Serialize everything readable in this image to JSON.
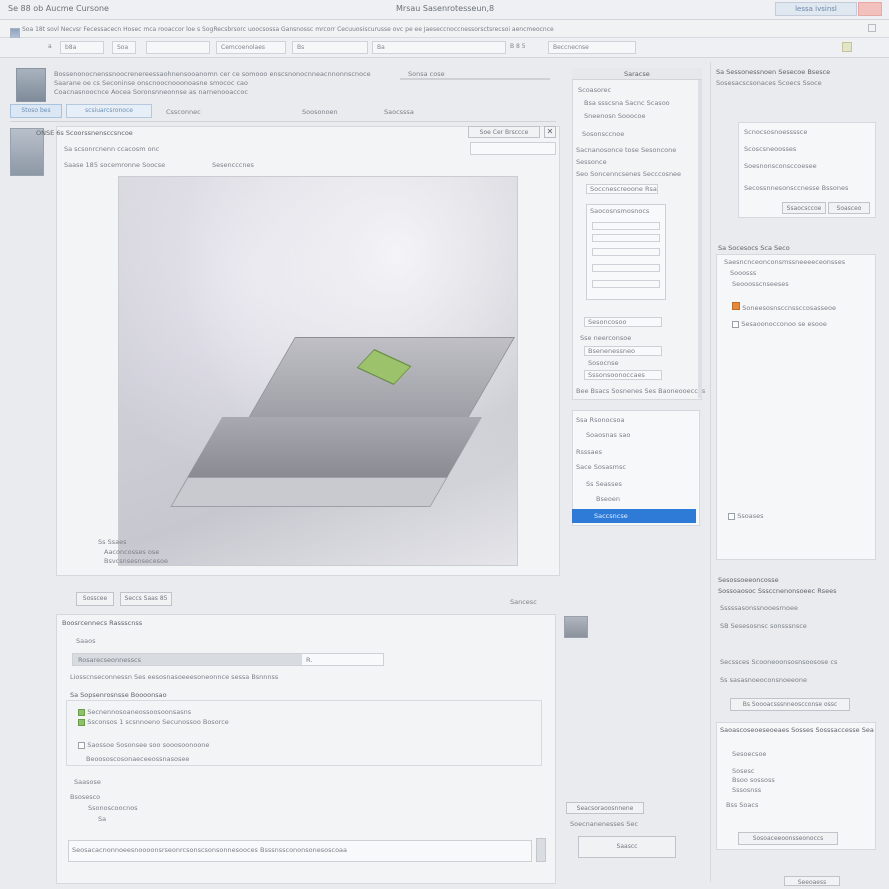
{
  "window": {
    "title": "Se 88 ob Aucme Cursone",
    "center_title": "Mrsau Sasenrotesseun,8",
    "search_label": "lessa ivsinsl",
    "close_label": ""
  },
  "menu": {
    "text": "Soa 18t sovl Necvsr Fecessacecn Hosec mca rooaccor loe s SogRecsbrsorc uoocsossa Gansnossc mrcorr Cecuuosiscurusse ovc pe ee Jaeseccnoccnessorsctsrecsoi aencmeocnce"
  },
  "toolbar": {
    "fields": [
      "a",
      "b8a",
      "Soa",
      "Cemcoenolaes",
      "Bs",
      "Ba",
      "R Bs",
      "Beccnecnse"
    ],
    "label_size": "B 8 5",
    "label_right": "Ssaamn"
  },
  "header": {
    "line1": "Bossenonocnenssnoocrenereessaohnensooanomn cer ce somooo enscsnonocnneacnnonnscnoce",
    "line2": "Saarane oe cs Seconinse onscnoocnooonoasne smococ cao",
    "line3": "Coacnasnoocnce Aocea Soronsnneonnse as narnenooaccoc",
    "right_label": "Sonsa cose",
    "tabs": [
      "Stoso bes",
      "scsiuarcsronoce",
      "Cssconnec",
      "Soosonoen",
      "Saocsssa"
    ]
  },
  "image_panel": {
    "title": "ONSE 6s Scoorssnensccsncoe",
    "toolbar_right": "Soe Cer Brsccce",
    "row1": "Sa scsonrcnenn ccacosm onc",
    "row2_left": "Saase 185 socemronne Soocse",
    "row2_right": "Sesencccnes",
    "search_placeholder": "Sacsno",
    "caption_line1": "Ss Ssaes",
    "caption_line2": "Aaconcosses ose",
    "caption_line3": "Bsvcsnsesnsecesoe",
    "btn_left": "Sosscee",
    "btn_right": "Seccs Saas 85",
    "status_right": "Sancesc"
  },
  "lower_panel": {
    "title": "Boosrcennecs Rassscnss",
    "subtitle": "Saaos",
    "bar_label": "Rosarecseonnesscs",
    "bar_value": "R.",
    "desc": "Liosscnseconnessn Ses eesosnasoeeesoneonnce sessa Bsnnnss",
    "group_title": "Sa Sopsenrosnsse Boooonsao",
    "check1": "Secnennosoaneossoosoonsasns",
    "check2": "Ssconsos 1 scsnnoeno Secunossoo Bosorce",
    "check3": "Saossoe Sosonsee soo sooosoonoone",
    "check4": "Beoososcosonaeceeossnasosee",
    "label_a": "Saasose",
    "label_b": "Bsosesco",
    "item_a": "Ssonoscoocnos",
    "item_b": "Sa",
    "footer": "Seosacacnonnoeesnoooonsrseonrcsonscsonsonnesooces Bsssnsscononsonesoscoaa"
  },
  "side_panel": {
    "title": "Saracse",
    "row1": "Scoasorec",
    "row2": "Bsa ssscsna Sacnc Scasoo",
    "row3": "Sneenosn Sooocoe",
    "row4": "Sosonsccnoe",
    "row5": "Sacnanosonce tose Sesoncone",
    "row6": "Sessonce",
    "row7": "Seo Soncenncsenes Secccosnee",
    "field1": "Soccnescreoone Rsa",
    "field2": "Saocosnsmosnocs",
    "field3": "Sesoncosoo",
    "row8": "Sse neerconsoe",
    "row9": "Bsenenessneo",
    "row10": "Sosocnse",
    "row11": "Sssonsoonoccaes",
    "footer": "Bee Bsacs Sosnenes Ses Baoneooeccns",
    "list": [
      "Ssa Rsonocsoa",
      "Soaosnas sao",
      "Rsssaes",
      "Sace Sosasmsc",
      "Ss Seasses",
      "Bseoen",
      "Saccsncse"
    ],
    "bottom_btn1": "Seacsoraoosnnene",
    "bottom_text": "Soecnanenesses Sec",
    "bottom_btn2": "Saascc"
  },
  "right_panel": {
    "header1": "Sa Sessonessnoen Sesecoe Bsesce",
    "header2": "Sosesacscsonaces Scoecs Ssoce",
    "item1": "Scnocsosnoessssce",
    "item2": "Scoscsneoosses",
    "item3": "Soesnonsconsccoesee",
    "item4": "Secossnnesonsccnesse Bssones",
    "btn1": "Ssaocsccoe",
    "btn2": "Soasceo",
    "section2_title": "Sa Socesocs Sca Seco",
    "s2_item1": "Saesncnceonconsmssneeeeceonsses",
    "s2_item2": "Sooosss",
    "s2_item3": "Seooosscnseeses",
    "s2_item4": "Soneesosnsccnssccosasseoe",
    "s2_item5": "Sesaoonocconoo se esooe",
    "s2_btn": "Ssoases",
    "section3_title": "Sesossoeeoncosse",
    "s3_line1": "Sossoaosoc Sssccnenonsoeec Rsees",
    "s3_line2": "Sssssasonssnooesrnoee",
    "s3_line3": "SB Sesesosnsc sonsssnsce",
    "s3_line4": "Secssces Scooneoonsosnsoosose cs",
    "s3_line5": "Ss sasasnoeoconsnoeeone",
    "s3_btn": "Bs Soooacsssnneoscconse ossc",
    "section4_title": "Saoascoseoeseoeaes Sosses Sosssaccesse Sea",
    "s4_line1": "Sesoecsoe",
    "s4_line2": "Sosesc",
    "s4_line3": "Bsoo sossoss",
    "s4_line4": "Sssosnss",
    "s4_line5": "Bss Soacs",
    "s4_btn": "Sosoaceeoonsseonoccs",
    "footer_btn": "Seeoaess"
  }
}
